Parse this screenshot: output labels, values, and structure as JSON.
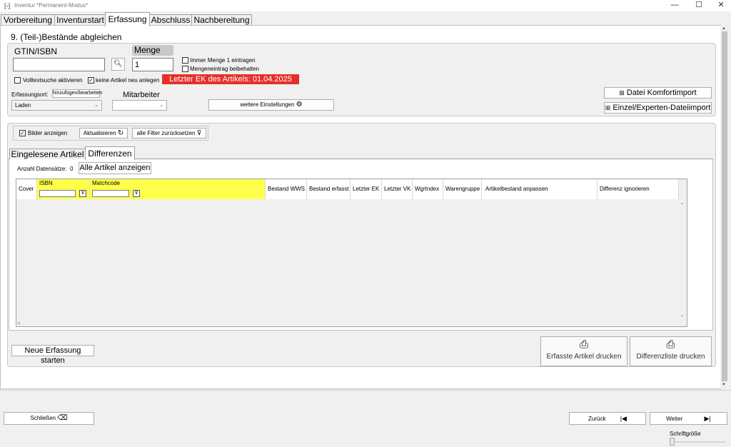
{
  "window": {
    "title": "Inventur *Permanent-Modus*"
  },
  "tabs": [
    {
      "label": "Vorbereitung"
    },
    {
      "label": "Inventurstart"
    },
    {
      "label": "Erfassung"
    },
    {
      "label": "Abschluss"
    },
    {
      "label": "Nachbereitung"
    }
  ],
  "page": {
    "heading": "9. (Teil-)Bestände abgleichen"
  },
  "entry": {
    "gtin_label": "GTIN/ISBN",
    "gtin_value": "",
    "menge_label": "Menge",
    "menge_value": "1",
    "immer_menge_label": "Immer Menge 1 eintragen",
    "mengeneintrag_label": "Mengeneintrag beibehalten",
    "volltext_label": "Volltextsuche aktivieren",
    "keine_artikel_label": "keine Artikel neu anlegen",
    "ek_notice": "Letzter EK des Artikels: 01.04.2025",
    "erfassungsort_label": "Erfassungsort:",
    "hinzufuegen_label": "hinzufügen/bearbeiten",
    "ort_value": "Laden",
    "mitarbeiter_label": "Mitarbeiter",
    "mitarbeiter_value": "",
    "weitere_label": "weitere Einstellungen",
    "komfortimport_label": "Datei Komfortimport",
    "experten_label": "Einzel/Experten-Dateiimport"
  },
  "filters": {
    "bilder_label": "Bilder anzeigen",
    "aktualisieren_label": "Aktualisieren",
    "reset_label": "alle Filter zurücksetzen"
  },
  "subtabs": [
    {
      "label": "Eingelesene Artikel"
    },
    {
      "label": "Differenzen"
    }
  ],
  "records": {
    "count_label": "Anzahl Datensätze:",
    "count": "0",
    "show_all_label": "Alle Artikel anzeigen"
  },
  "table": {
    "columns": [
      "Cover",
      "ISBN",
      "Matchcode",
      "Bestand WWS",
      "Bestand erfasst",
      "Letzter EK",
      "Letzter VK",
      "WgrIndex",
      "Warengruppe",
      "Artikelbestand anpassen",
      "Differenz ignorieren"
    ],
    "rows": []
  },
  "actions": {
    "neue_erfassung_label": "Neue Erfassung starten",
    "erfasste_drucken_label": "Erfasste Artikel drucken",
    "differenzliste_label": "Differenzliste drucken"
  },
  "footer": {
    "schliessen_label": "Schließen",
    "zurueck_label": "Zurück",
    "weiter_label": "Weiter",
    "schriftgroesse_label": "Schriftgröße",
    "font_size_level": 0
  }
}
